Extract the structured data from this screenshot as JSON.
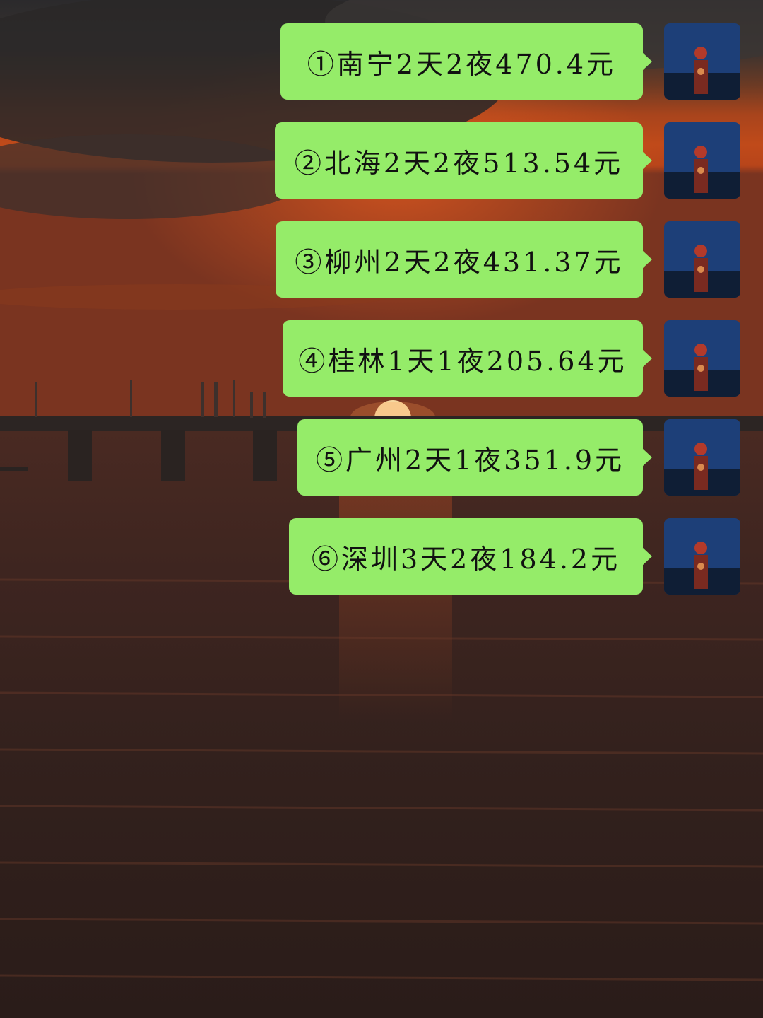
{
  "colors": {
    "bubble": "#95ec69",
    "text": "#111111",
    "sky_top": "#2e2a2a",
    "sunset": "#c24a1c",
    "sea": "#3a2520"
  },
  "messages": [
    {
      "text": "①南宁2天2夜470.4元",
      "avatar_icon": "user-avatar-icon"
    },
    {
      "text": "②北海2天2夜513.54元",
      "avatar_icon": "user-avatar-icon"
    },
    {
      "text": "③柳州2天2夜431.37元",
      "avatar_icon": "user-avatar-icon"
    },
    {
      "text": "④桂林1天1夜205.64元",
      "avatar_icon": "user-avatar-icon"
    },
    {
      "text": "⑤广州2天1夜351.9元",
      "avatar_icon": "user-avatar-icon"
    },
    {
      "text": "⑥深圳3天2夜184.2元",
      "avatar_icon": "user-avatar-icon"
    }
  ]
}
